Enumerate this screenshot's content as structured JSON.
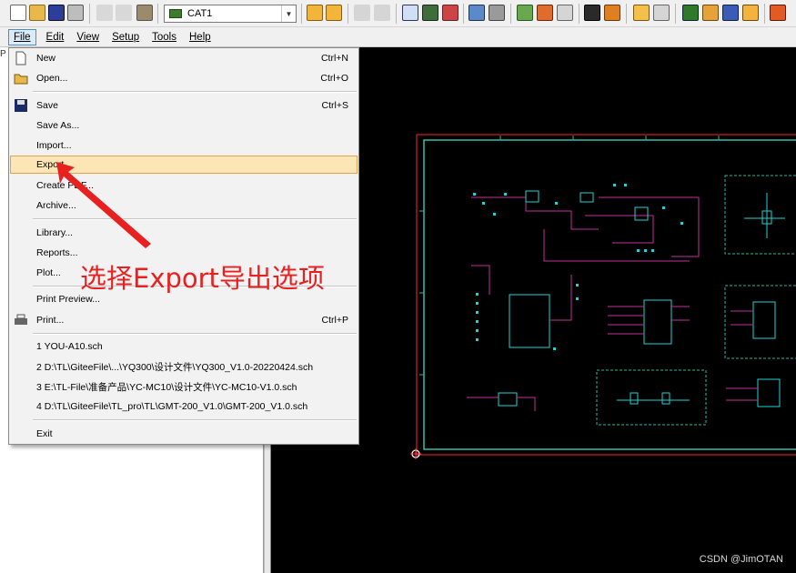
{
  "toolbar": {
    "layer_combo_value": "CAT1"
  },
  "menubar": {
    "items": [
      {
        "label": "File",
        "active": true
      },
      {
        "label": "Edit"
      },
      {
        "label": "View"
      },
      {
        "label": "Setup"
      },
      {
        "label": "Tools"
      },
      {
        "label": "Help"
      }
    ]
  },
  "left_pane": {
    "tab_letter": "P"
  },
  "file_menu": {
    "items": [
      {
        "label": "New",
        "shortcut": "Ctrl+N",
        "icon": "new-document-icon"
      },
      {
        "label": "Open...",
        "shortcut": "Ctrl+O",
        "icon": "open-folder-icon"
      },
      {
        "label": "Save",
        "shortcut": "Ctrl+S",
        "icon": "save-disk-icon"
      },
      {
        "label": "Save As..."
      },
      {
        "label": "Import..."
      },
      {
        "label": "Export...",
        "highlighted": true
      },
      {
        "label": "Create PDF..."
      },
      {
        "label": "Archive..."
      },
      {
        "label": "Library..."
      },
      {
        "label": "Reports..."
      },
      {
        "label": "Plot..."
      },
      {
        "label": "Print Preview..."
      },
      {
        "label": "Print...",
        "shortcut": "Ctrl+P",
        "icon": "printer-icon"
      },
      {
        "label": "1 YOU-A10.sch"
      },
      {
        "label": "2 D:\\TL\\GiteeFile\\...\\YQ300\\设计文件\\YQ300_V1.0-20220424.sch"
      },
      {
        "label": "3 E:\\TL-File\\准备产品\\YC-MC10\\设计文件\\YC-MC10-V1.0.sch"
      },
      {
        "label": "4 D:\\TL\\GiteeFile\\TL_pro\\TL\\GMT-200_V1.0\\GMT-200_V1.0.sch"
      },
      {
        "label": "Exit"
      }
    ]
  },
  "annotation": {
    "text": "选择Export导出选项",
    "color": "#e8201f"
  },
  "watermark": "CSDN @JimOTAN",
  "colors": {
    "canvas_bg": "#000000",
    "board_outline": "#d02020",
    "border_teal": "#2fb3a0",
    "wire_magenta": "#c0309a",
    "pin_cyan": "#1fd3d3",
    "highlight_bg": "#fde6b5"
  }
}
